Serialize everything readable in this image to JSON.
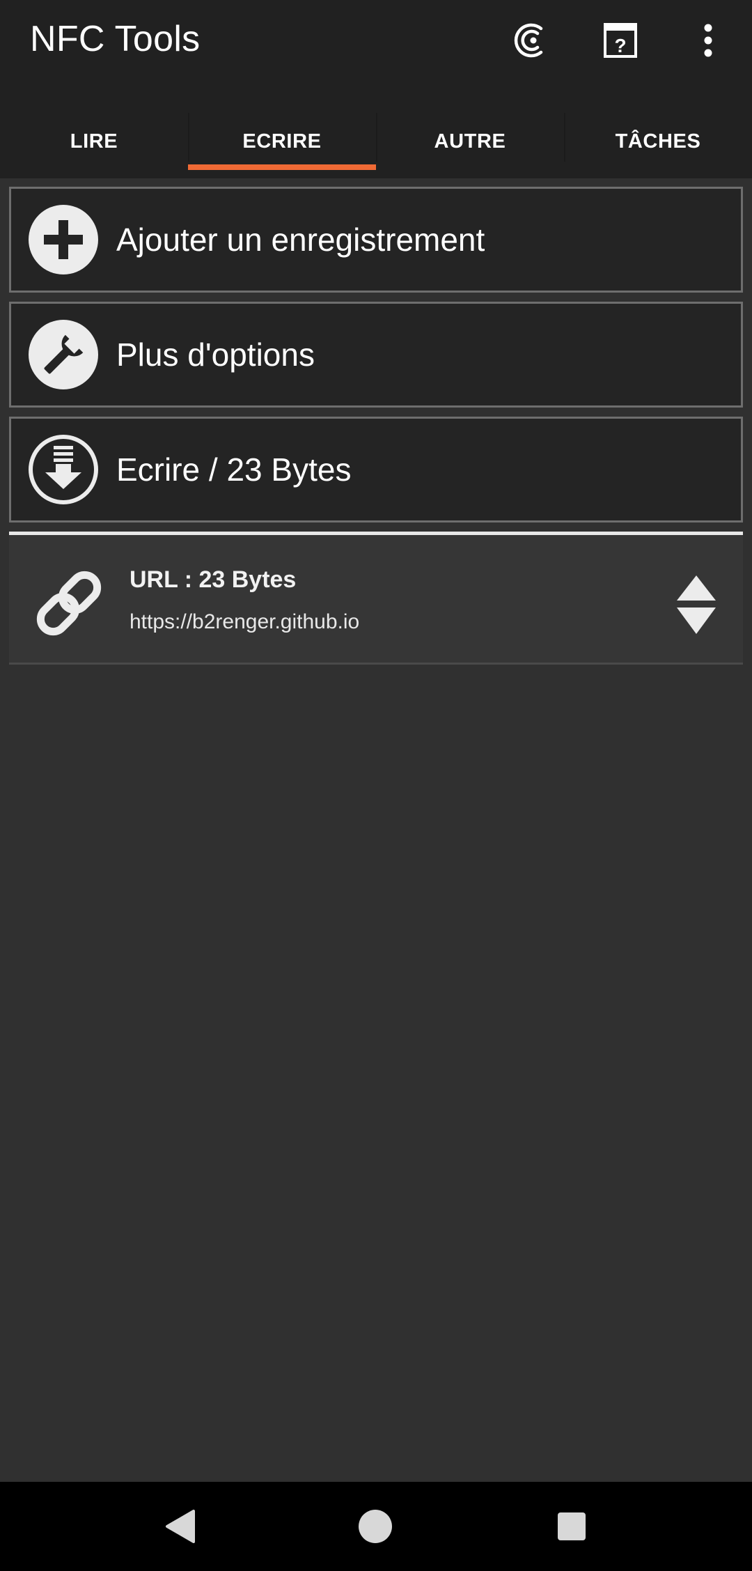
{
  "app": {
    "title": "NFC Tools",
    "accent_color": "#f06a35",
    "toolbar_background": "#212121",
    "background": "#303030"
  },
  "toolbar": {
    "icons": [
      "nfc-scan-icon",
      "help-icon",
      "more-vert-icon"
    ]
  },
  "tabs": [
    {
      "label": "LIRE",
      "selected": false
    },
    {
      "label": "ECRIRE",
      "selected": true
    },
    {
      "label": "AUTRE",
      "selected": false
    },
    {
      "label": "TÂCHES",
      "selected": false
    }
  ],
  "actions": {
    "add_record": {
      "label": "Ajouter un enregistrement",
      "icon": "plus-circle-icon"
    },
    "more_options": {
      "label": "Plus d'options",
      "icon": "wrench-icon"
    },
    "write": {
      "label": "Ecrire / 23 Bytes",
      "icon": "write-download-icon"
    }
  },
  "records": [
    {
      "title": "URL : 23 Bytes",
      "value": "https://b2renger.github.io",
      "icon": "link-icon",
      "handle_icon": "reorder-handle-icon"
    }
  ],
  "navigation": {
    "buttons": [
      "back-icon",
      "home-icon",
      "recents-icon"
    ]
  }
}
